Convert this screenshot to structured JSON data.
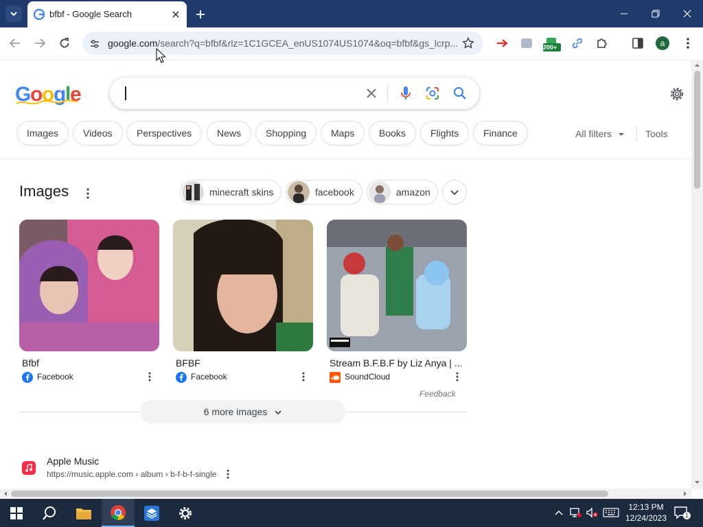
{
  "browser": {
    "tab_title": "bfbf - Google Search",
    "url_host": "google.com",
    "url_path": "/search?q=bfbf&rlz=1C1GCEA_enUS1074US1074&oq=bfbf&gs_lcrp...",
    "extension_badge": "200+",
    "profile_initial": "a"
  },
  "search": {
    "query": "",
    "logo_text": "Google"
  },
  "filters": [
    "Images",
    "Videos",
    "Perspectives",
    "News",
    "Shopping",
    "Maps",
    "Books",
    "Flights",
    "Finance"
  ],
  "all_filters_label": "All filters",
  "tools_label": "Tools",
  "images_section": {
    "heading": "Images",
    "suggestions": [
      "minecraft skins",
      "facebook",
      "amazon"
    ],
    "results": [
      {
        "title": "Bfbf",
        "source": "Facebook"
      },
      {
        "title": "BFBF",
        "source": "Facebook"
      },
      {
        "title": "Stream B.F.B.F by Liz Anya | ...",
        "source": "SoundCloud"
      }
    ],
    "feedback_label": "Feedback",
    "more_label": "6 more images"
  },
  "result": {
    "site_name": "Apple Music",
    "cite": "https://music.apple.com › album › b-f-b-f-single"
  },
  "taskbar": {
    "time": "12:13 PM",
    "date": "12/24/2023",
    "notification_count": "1"
  }
}
